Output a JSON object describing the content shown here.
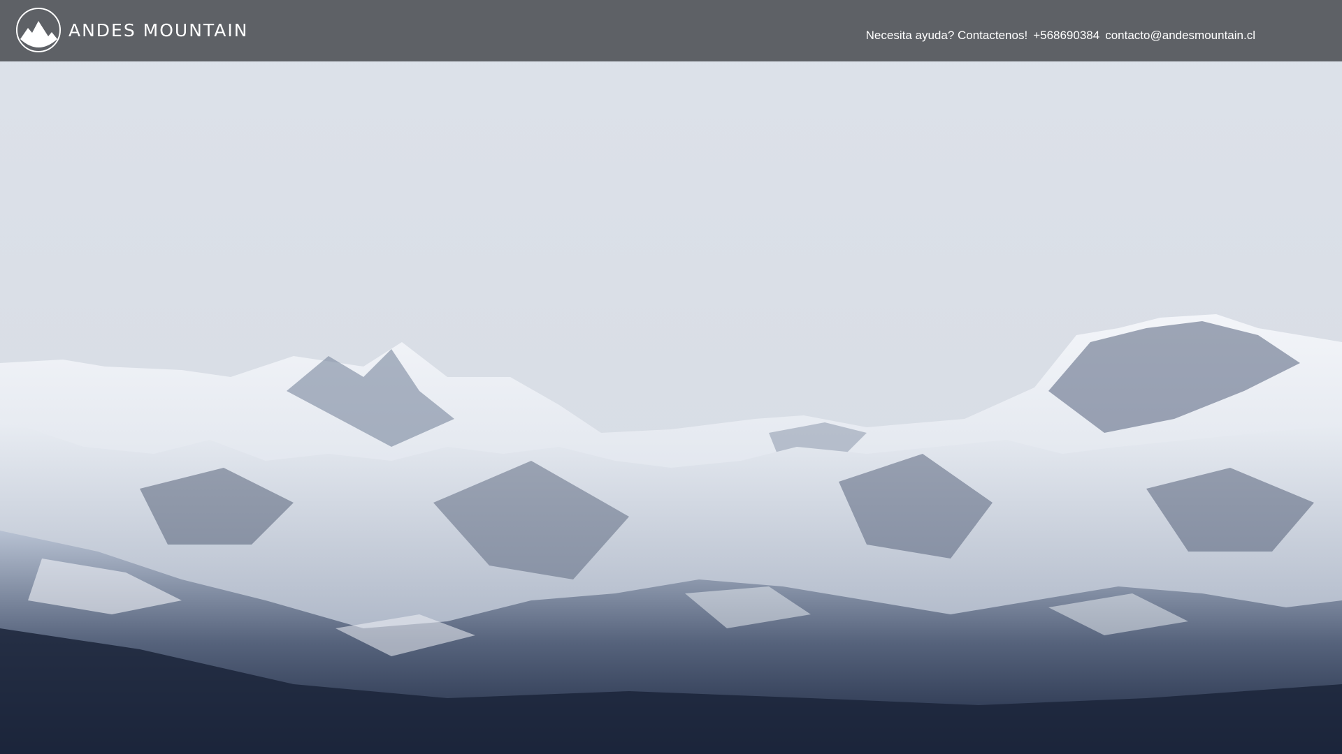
{
  "header": {
    "brand_name": "ANDES MOUNTAIN",
    "logo_icon": "mountain-logo-icon",
    "contact": {
      "help_text": "Necesita ayuda? Contactenos!",
      "phone": "+568690384",
      "email": "contacto@andesmountain.cl"
    }
  },
  "hero": {
    "image": "snowy-andes-mountain-range-photo"
  },
  "colors": {
    "header_bg": "#5e6166",
    "header_text": "#ffffff",
    "sky": "#dfe3ea",
    "rock_dark": "#2e3b55"
  }
}
